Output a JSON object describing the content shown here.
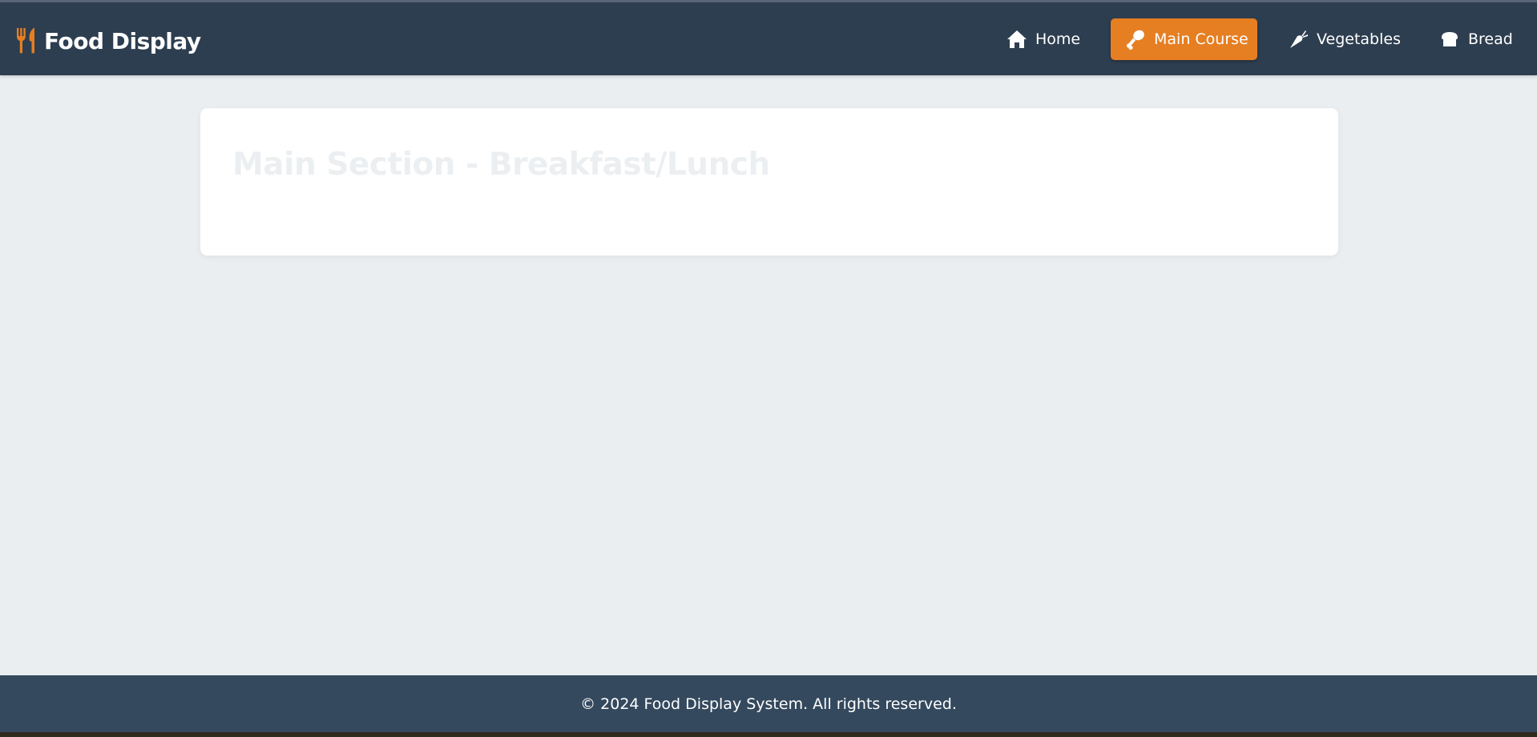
{
  "brand": {
    "title": "Food Display",
    "icon": "utensils-icon",
    "icon_color": "#e67e22"
  },
  "nav": {
    "items": [
      {
        "label": "Home",
        "icon": "home-icon",
        "active": false
      },
      {
        "label": "Main Course",
        "icon": "drumstick-icon",
        "active": true
      },
      {
        "label": "Vegetables",
        "icon": "carrot-icon",
        "active": false
      },
      {
        "label": "Bread",
        "icon": "bread-icon",
        "active": false
      }
    ]
  },
  "main": {
    "section_title": "Main Section - Breakfast/Lunch"
  },
  "footer": {
    "text": "© 2024 Food Display System. All rights reserved."
  },
  "colors": {
    "navbar_bg": "#2d3e50",
    "accent": "#e67e22",
    "page_bg": "#ebeef0",
    "footer_bg": "#34495e",
    "card_bg": "#ffffff"
  }
}
